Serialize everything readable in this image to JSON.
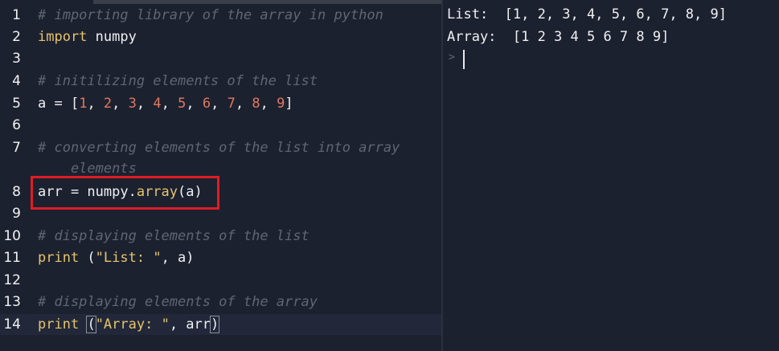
{
  "editor": {
    "lines": [
      {
        "num": "1",
        "tokens": [
          {
            "t": "# importing library of the array in python",
            "c": "comment"
          }
        ]
      },
      {
        "num": "2",
        "tokens": [
          {
            "t": "import",
            "c": "kw"
          },
          {
            "t": " numpy",
            "c": "punct"
          }
        ]
      },
      {
        "num": "3",
        "tokens": []
      },
      {
        "num": "4",
        "tokens": [
          {
            "t": "# initilizing elements of the list",
            "c": "comment"
          }
        ]
      },
      {
        "num": "5",
        "tokens": [
          {
            "t": "a = [",
            "c": "punct"
          },
          {
            "t": "1",
            "c": "num"
          },
          {
            "t": ", ",
            "c": "punct"
          },
          {
            "t": "2",
            "c": "num"
          },
          {
            "t": ", ",
            "c": "punct"
          },
          {
            "t": "3",
            "c": "num"
          },
          {
            "t": ", ",
            "c": "punct"
          },
          {
            "t": "4",
            "c": "num"
          },
          {
            "t": ", ",
            "c": "punct"
          },
          {
            "t": "5",
            "c": "num"
          },
          {
            "t": ", ",
            "c": "punct"
          },
          {
            "t": "6",
            "c": "num"
          },
          {
            "t": ", ",
            "c": "punct"
          },
          {
            "t": "7",
            "c": "num"
          },
          {
            "t": ", ",
            "c": "punct"
          },
          {
            "t": "8",
            "c": "num"
          },
          {
            "t": ", ",
            "c": "punct"
          },
          {
            "t": "9",
            "c": "num"
          },
          {
            "t": "]",
            "c": "punct"
          }
        ]
      },
      {
        "num": "6",
        "tokens": []
      },
      {
        "num": "7",
        "tokens": [
          {
            "t": "# converting elements of the list into array",
            "c": "comment"
          }
        ]
      },
      {
        "num": "",
        "tokens": [
          {
            "t": "    elements",
            "c": "comment"
          }
        ]
      },
      {
        "num": "8",
        "tokens": [
          {
            "t": "arr = numpy.",
            "c": "punct"
          },
          {
            "t": "array",
            "c": "fn"
          },
          {
            "t": "(a)",
            "c": "punct"
          }
        ]
      },
      {
        "num": "9",
        "tokens": []
      },
      {
        "num": "10",
        "tokens": [
          {
            "t": "# displaying elements of the list",
            "c": "comment"
          }
        ]
      },
      {
        "num": "11",
        "tokens": [
          {
            "t": "print",
            "c": "kw"
          },
          {
            "t": " (",
            "c": "punct"
          },
          {
            "t": "\"List: \"",
            "c": "str"
          },
          {
            "t": ", a)",
            "c": "punct"
          }
        ]
      },
      {
        "num": "12",
        "tokens": []
      },
      {
        "num": "13",
        "tokens": [
          {
            "t": "# displaying elements of the array",
            "c": "comment"
          }
        ]
      },
      {
        "num": "14",
        "tokens": [
          {
            "t": "print",
            "c": "kw"
          },
          {
            "t": " ",
            "c": "punct"
          },
          {
            "t": "(",
            "c": "punct",
            "box": true
          },
          {
            "t": "\"Array: \"",
            "c": "str"
          },
          {
            "t": ", arr",
            "c": "punct"
          },
          {
            "t": ")",
            "c": "punct",
            "box": true
          }
        ]
      }
    ]
  },
  "console": {
    "output_lines": [
      "List:  [1, 2, 3, 4, 5, 6, 7, 8, 9]",
      "Array:  [1 2 3 4 5 6 7 8 9]"
    ],
    "prompt_symbol": ">"
  },
  "colors": {
    "background": "#1c2130",
    "comment": "#5f6672",
    "keyword": "#e6c46b",
    "number": "#e0785c",
    "highlight_box": "#e01c24"
  }
}
